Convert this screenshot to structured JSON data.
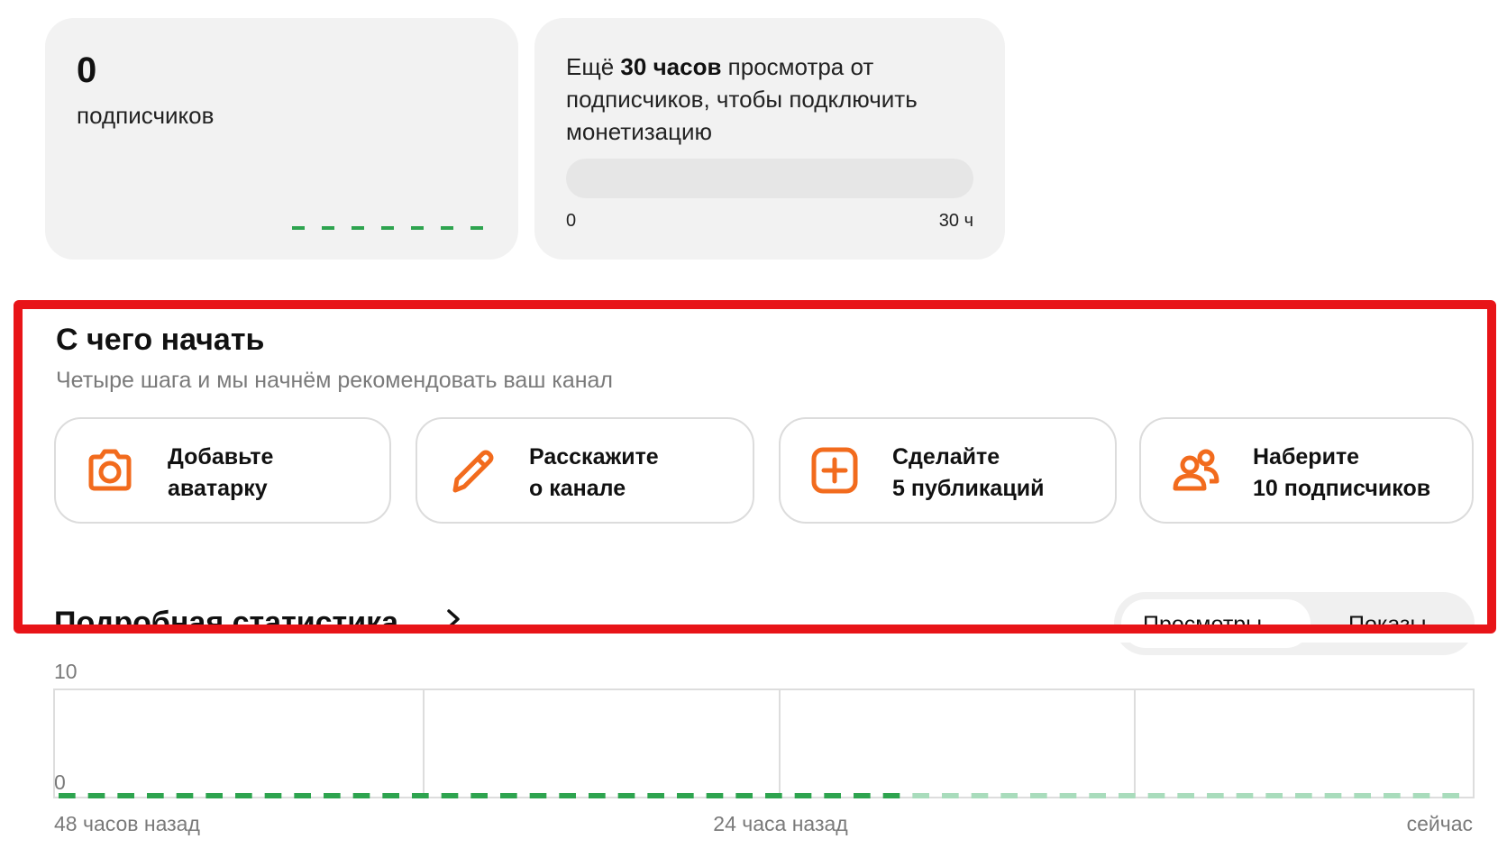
{
  "subscribers": {
    "count": "0",
    "label": "подписчиков"
  },
  "monetization": {
    "text_prefix": "Ещё ",
    "text_bold": "30 часов",
    "text_suffix": " просмотра от подписчиков, чтобы подключить монетизацию",
    "progress_min": "0",
    "progress_max": "30 ч",
    "progress_fraction": 0
  },
  "start": {
    "title": "С чего начать",
    "subtitle": "Четыре шага и мы начнём рекомендовать ваш канал",
    "steps": [
      {
        "icon": "camera-icon",
        "line1": "Добавьте",
        "line2": "аватарку"
      },
      {
        "icon": "pencil-icon",
        "line1": "Расскажите",
        "line2": "о канале"
      },
      {
        "icon": "plus-square-icon",
        "line1": "Сделайте",
        "line2": "5 публикаций"
      },
      {
        "icon": "users-icon",
        "line1": "Наберите",
        "line2": "10 подписчиков"
      }
    ]
  },
  "stats": {
    "title": "Подробная статистика",
    "tabs": [
      "Просмотры",
      "Показы"
    ],
    "active_tab": 0
  },
  "colors": {
    "accent": "#f26b1d",
    "green": "#2ea44f",
    "green_light": "#a9dcbc",
    "highlight": "#e81418"
  },
  "chart_data": {
    "type": "line",
    "x_labels": [
      "48 часов назад",
      "24 часа назад",
      "сейчас"
    ],
    "y_ticks": [
      "10",
      "0"
    ],
    "ylim": [
      0,
      10
    ],
    "series": [
      {
        "values": [
          0,
          0,
          0,
          0,
          0,
          0,
          0,
          0,
          0,
          0,
          0,
          0,
          0,
          0,
          0,
          0,
          0,
          0,
          0,
          0,
          0,
          0,
          0,
          0,
          0,
          0,
          0,
          0,
          0,
          0,
          0,
          0,
          0,
          0,
          0,
          0,
          0,
          0,
          0,
          0,
          0,
          0,
          0,
          0,
          0,
          0,
          0,
          0
        ]
      }
    ]
  }
}
